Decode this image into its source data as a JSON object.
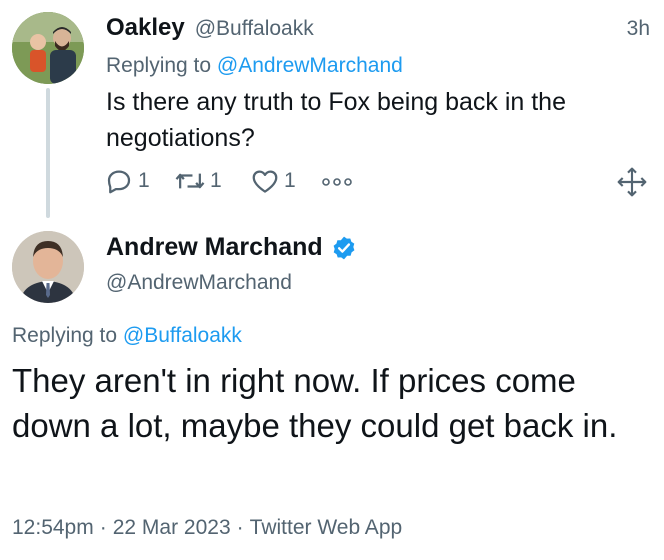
{
  "reply_tweet": {
    "name": "Oakley",
    "handle": "@Buffaloakk",
    "time": "3h",
    "replying_prefix": "Replying to",
    "replying_to": "@AndrewMarchand",
    "text": "Is there any truth to Fox being back in the negotiations?",
    "actions": {
      "reply_icon": "reply-icon",
      "reply_count": "1",
      "retweet_icon": "retweet-icon",
      "retweet_count": "1",
      "like_icon": "heart-icon",
      "like_count": "1",
      "more_icon": "more-icon",
      "move_icon": "move-icon"
    }
  },
  "main_tweet": {
    "name": "Andrew Marchand",
    "verified_icon": "verified-badge-icon",
    "handle": "@AndrewMarchand",
    "replying_prefix": "Replying to",
    "replying_to": "@Buffaloakk",
    "text": "They aren't in right now. If prices come down a lot, maybe they could get back in.",
    "time": "12:54pm",
    "date": "22 Mar 2023",
    "source": "Twitter Web App"
  },
  "colors": {
    "text": "#0f1419",
    "secondary": "#536471",
    "link": "#1d9bf0",
    "thread_line": "#cfd9de"
  }
}
